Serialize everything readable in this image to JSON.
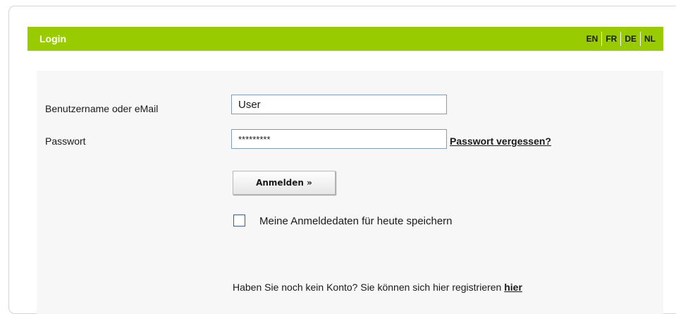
{
  "header": {
    "title": "Login",
    "accent_color": "#99cc00",
    "languages": [
      "EN",
      "FR",
      "DE",
      "NL"
    ]
  },
  "form": {
    "username_label": "Benutzername oder eMail",
    "username_value": "User",
    "password_label": "Passwort",
    "password_value": "*********",
    "forgot_password_link": "Passwort vergessen?",
    "submit_label": "Anmelden »",
    "remember_label": "Meine Anmeldedaten für heute speichern",
    "remember_checked": false
  },
  "register": {
    "text": "Haben Sie noch kein Konto? Sie können sich hier registrieren",
    "link_label": "hier"
  }
}
